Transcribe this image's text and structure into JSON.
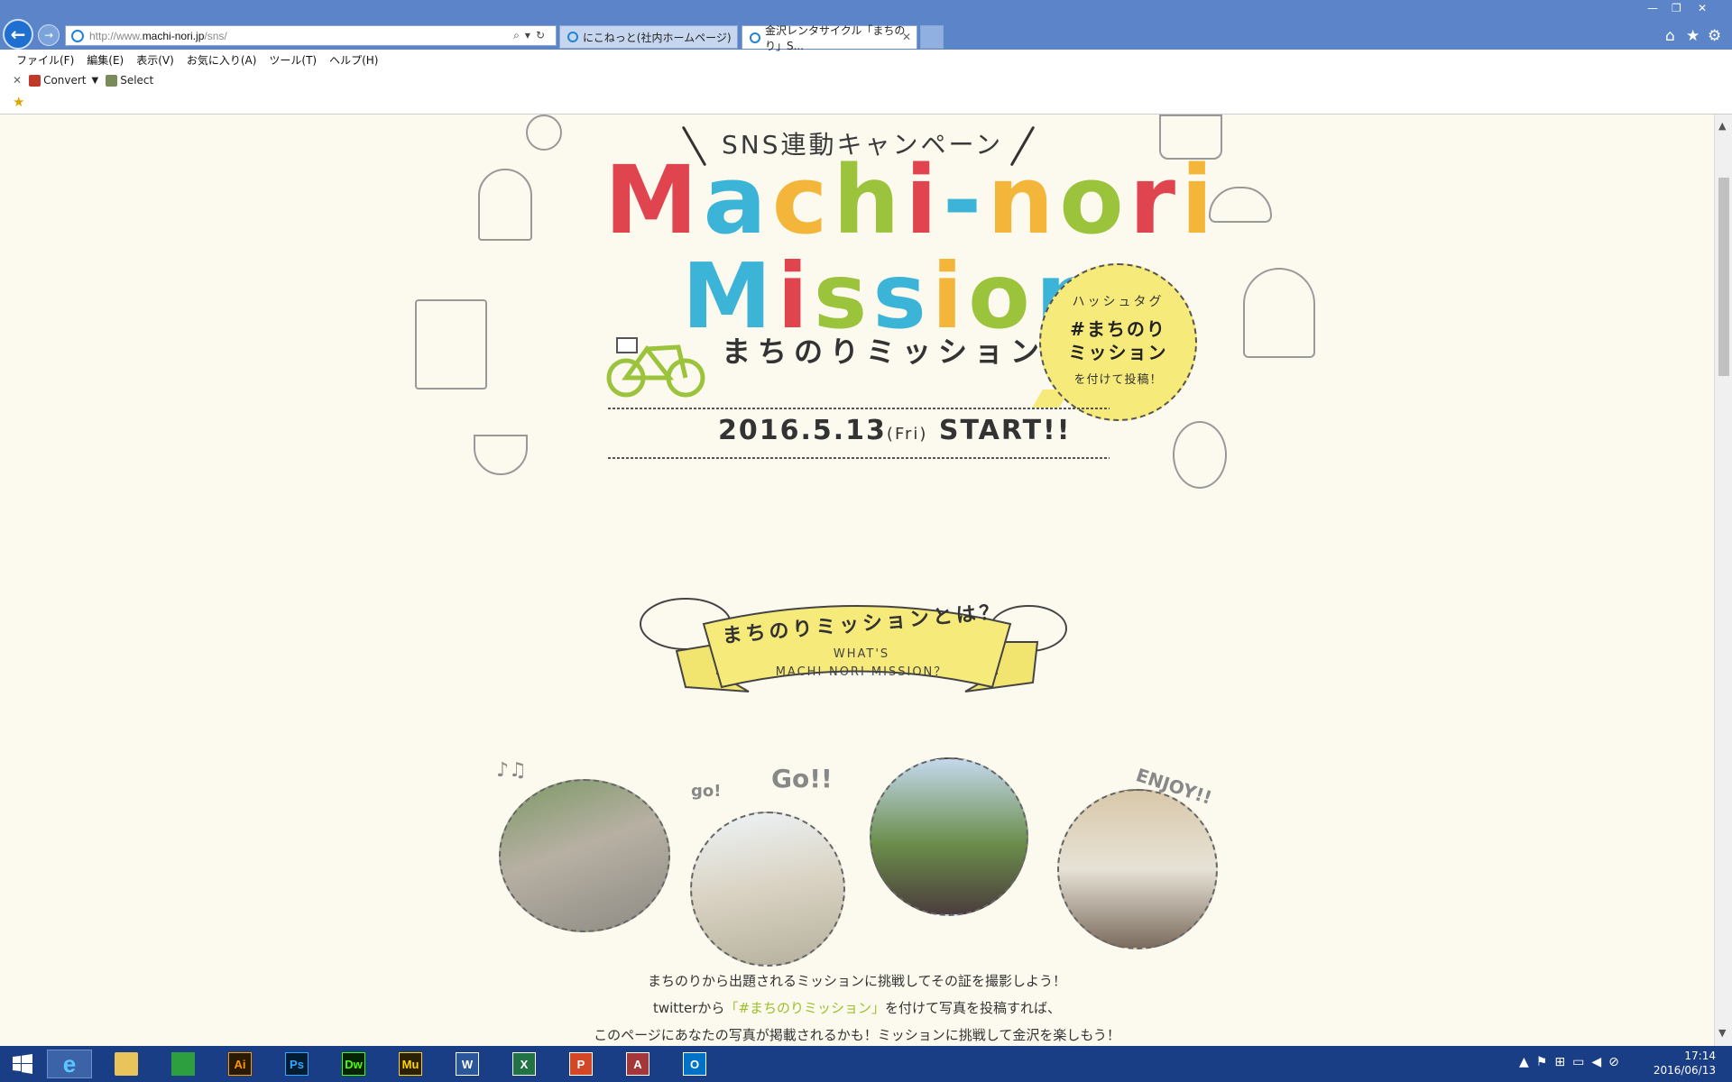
{
  "browser": {
    "address_url_prefix": "http://www.",
    "address_url_domain": "machi-nori.jp",
    "address_url_path": "/sns/",
    "tabs": [
      {
        "label": "にこねっと(社内ホームページ)"
      },
      {
        "label": "金沢レンタサイクル「まちのり」S..."
      }
    ],
    "menu": [
      "ファイル(F)",
      "編集(E)",
      "表示(V)",
      "お気に入り(A)",
      "ツール(T)",
      "ヘルプ(H)"
    ],
    "cmd_convert": "Convert",
    "cmd_select": "Select"
  },
  "page": {
    "campaign": "SNS連動キャンペーン",
    "title_line1": "Machi-nori",
    "title_line2": "Mission",
    "title_jp": "まちのりミッション",
    "date_main": "2016.5.13",
    "date_dow": "(Fri)",
    "date_start": "START!!",
    "bubble": {
      "line1": "ハッシュタグ",
      "line2": "#まちのり",
      "line3": "ミッション",
      "line4": "を付けて投稿！"
    },
    "ribbon_title": "まちのりミッションとは？",
    "ribbon_en1": "WHAT'S",
    "ribbon_en2": "MACHI-NORI MISSION？",
    "deco_go_small": "go!",
    "deco_go": "Go!!",
    "deco_enjoy": "ENJOY!!",
    "desc1": "まちのりから出題されるミッションに挑戦してその証を撮影しよう！",
    "desc2_a": "twitterから",
    "desc2_hl": "「#まちのりミッション」",
    "desc2_b": "を付けて写真を投稿すれば、",
    "desc3": "このページにあなたの写真が掲載されるかも！ミッションに挑戦して金沢を楽しもう！"
  },
  "title_colors": [
    "#e0454f",
    "#3cb4d8",
    "#f3b63a",
    "#9cc33c",
    "#e0454f",
    "#3cb4d8",
    "#f3b63a",
    "#9cc33c",
    "#e0454f",
    "#f3b63a"
  ],
  "title2_colors": [
    "#3cb4d8",
    "#e0454f",
    "#9cc33c",
    "#3cb4d8",
    "#f3b63a",
    "#9cc33c",
    "#3cb4d8"
  ],
  "taskbar": {
    "clock_time": "17:14",
    "clock_date": "2016/06/13",
    "apps": [
      {
        "label": "Ai",
        "bg": "#2b1900",
        "fg": "#ff9a00"
      },
      {
        "label": "Ps",
        "bg": "#001d34",
        "fg": "#31a8ff"
      },
      {
        "label": "Dw",
        "bg": "#072401",
        "fg": "#4bff00"
      },
      {
        "label": "Mu",
        "bg": "#2b2100",
        "fg": "#ffd400"
      },
      {
        "label": "W",
        "bg": "#2b579a",
        "fg": "#ffffff"
      },
      {
        "label": "X",
        "bg": "#217346",
        "fg": "#ffffff"
      },
      {
        "label": "P",
        "bg": "#d24726",
        "fg": "#ffffff"
      },
      {
        "label": "A",
        "bg": "#a4373a",
        "fg": "#ffffff"
      },
      {
        "label": "O",
        "bg": "#0072c6",
        "fg": "#ffffff"
      }
    ]
  }
}
